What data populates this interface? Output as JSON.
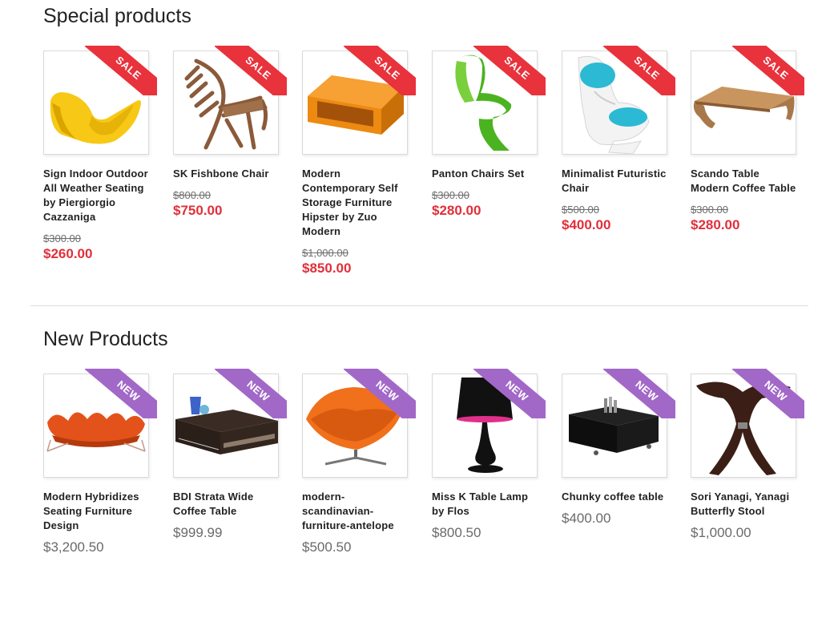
{
  "special": {
    "title": "Special products",
    "products": [
      {
        "name": "Sign Indoor Outdoor All Weather Seating by Piergiorgio Cazzaniga",
        "old_price": "$300.00",
        "price": "$260.00",
        "badge": "SALE",
        "icon": "yellow-lounge-chair"
      },
      {
        "name": "SK Fishbone Chair",
        "old_price": "$800.00",
        "price": "$750.00",
        "badge": "SALE",
        "icon": "wooden-fishbone-chair"
      },
      {
        "name": "Modern Contemporary Self Storage Furniture Hipster by Zuo Modern",
        "old_price": "$1,000.00",
        "price": "$850.00",
        "badge": "SALE",
        "icon": "orange-storage-cube"
      },
      {
        "name": "Panton Chairs Set",
        "old_price": "$300.00",
        "price": "$280.00",
        "badge": "SALE",
        "icon": "green-panton-chair"
      },
      {
        "name": "Minimalist Futuristic Chair",
        "old_price": "$500.00",
        "price": "$400.00",
        "badge": "SALE",
        "icon": "white-blue-futuristic-chair"
      },
      {
        "name": "Scando Table Modern Coffee Table",
        "old_price": "$300.00",
        "price": "$280.00",
        "badge": "SALE",
        "icon": "bent-wood-coffee-table"
      }
    ]
  },
  "new": {
    "title": "New Products",
    "products": [
      {
        "name": "Modern Hybridizes Seating Furniture Design",
        "price": "$3,200.50",
        "badge": "NEW",
        "icon": "orange-curved-sofa"
      },
      {
        "name": "BDI Strata Wide Coffee Table",
        "price": "$999.99",
        "badge": "NEW",
        "icon": "dark-wood-coffee-table"
      },
      {
        "name": "modern-scandinavian-furniture-antelope",
        "price": "$500.50",
        "badge": "NEW",
        "icon": "orange-shell-chair"
      },
      {
        "name": "Miss K Table Lamp by Flos",
        "price": "$800.50",
        "badge": "NEW",
        "icon": "black-table-lamp"
      },
      {
        "name": "Chunky coffee table",
        "price": "$400.00",
        "badge": "NEW",
        "icon": "black-cube-coffee-table"
      },
      {
        "name": "Sori Yanagi, Yanagi Butterfly Stool",
        "price": "$1,000.00",
        "badge": "NEW",
        "icon": "butterfly-stool"
      }
    ]
  },
  "colors": {
    "sale_ribbon": "#e8323c",
    "new_ribbon": "#a268c8",
    "sale_price": "#e0303b",
    "regular_price": "#6a6a6a"
  }
}
